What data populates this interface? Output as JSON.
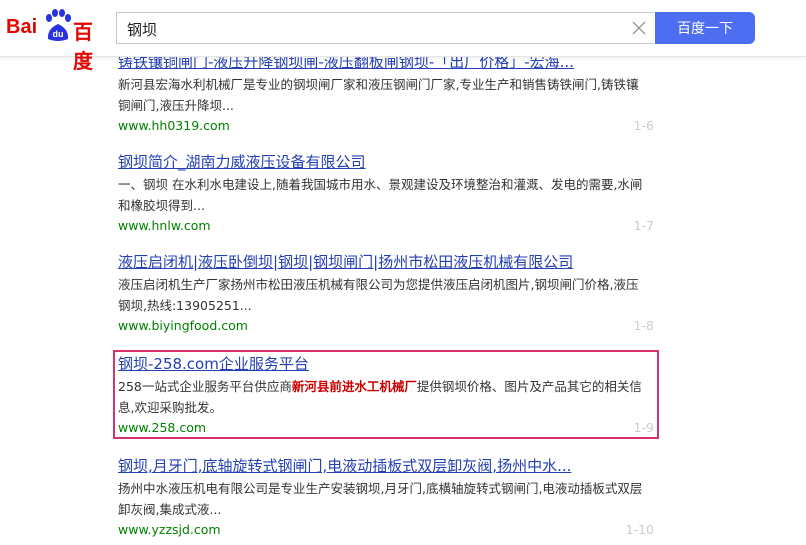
{
  "logo": {
    "latin": "Bai",
    "paw_text": "du",
    "chinese": "百度"
  },
  "search": {
    "query": "钢坝",
    "button_label": "百度一下"
  },
  "results": [
    {
      "title": "铸铁镶铜闸门-液压升降钢坝闸-液压翻板闸钢坝-「出厂价格」-宏海...",
      "abstract": "新河县宏海水利机械厂是专业的钢坝闸厂家和液压钢闸门厂家,专业生产和销售铸铁闸门,铸铁镶铜闸门,液压升降坝...",
      "url": "www.hh0319.com",
      "rank": "1-6"
    },
    {
      "title": "钢坝简介_湖南力威液压设备有限公司",
      "abstract": "一、钢坝 在水利水电建设上,随着我国城市用水、景观建设及环境整治和灌溉、发电的需要,水闸和橡胶坝得到...",
      "url": "www.hnlw.com",
      "rank": "1-7"
    },
    {
      "title": "液压启闭机|液压卧倒坝|钢坝|钢坝闸门|扬州市松田液压机械有限公司",
      "abstract": "液压启闭机生产厂家扬州市松田液压机械有限公司为您提供液压启闭机图片,钢坝闸门价格,液压钢坝,热线:13905251...",
      "url": "www.biyingfood.com",
      "rank": "1-8"
    },
    {
      "title": "钢坝-258.com企业服务平台",
      "abstract_pre": "258一站式企业服务平台供应商",
      "abstract_bold": "新河县前进水工机械厂",
      "abstract_post": "提供钢坝价格、图片及产品其它的相关信息,欢迎采购批发。",
      "url": "www.258.com",
      "rank": "1-9"
    },
    {
      "title": "钢坝,月牙门,底轴旋转式钢闸门,电液动插板式双层卸灰阀,扬州中水...",
      "abstract": "扬州中水液压机电有限公司是专业生产安装钢坝,月牙门,底横轴旋转式钢闸门,电液动插板式双层卸灰阀,集成式液...",
      "url": "www.yzzsjd.com",
      "rank": "1-10"
    }
  ],
  "colors": {
    "accent": "#4e6ef2",
    "title_link": "#2440b3",
    "url": "#008000",
    "highlight": "#d6336c",
    "brand_red": "#e10601"
  }
}
